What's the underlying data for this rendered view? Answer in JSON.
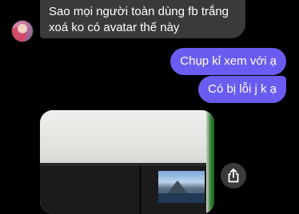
{
  "messages": {
    "incoming": {
      "line1": "Sao mọi người toàn dùng fb trắng",
      "line2": "xoá ko có avatar thế này"
    },
    "outgoing": [
      {
        "text": "Chụp kỉ xem với ạ"
      },
      {
        "text": "Có bị lỗi j k ạ"
      }
    ]
  },
  "icons": {
    "share": "share-icon",
    "avatar": "avatar"
  },
  "colors": {
    "outgoing_bubble": "#6a5cf0",
    "incoming_bubble": "#3a3a3c",
    "background": "#000000"
  }
}
